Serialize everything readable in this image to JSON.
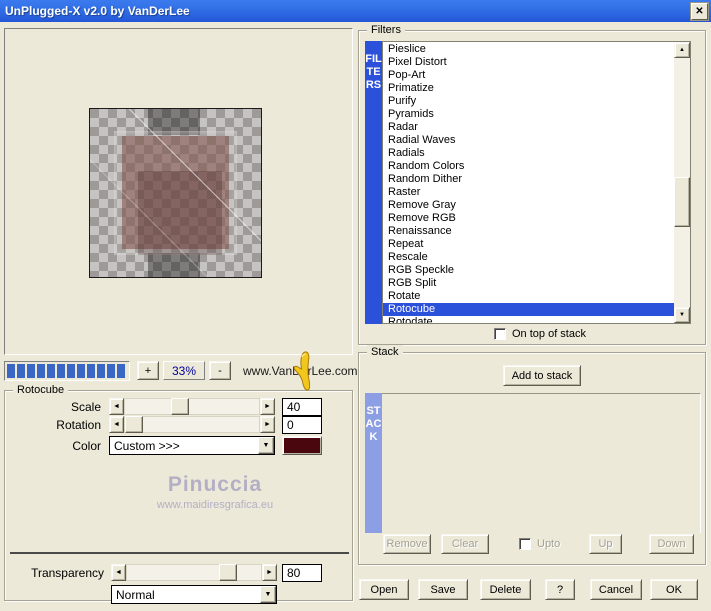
{
  "window": {
    "title": "UnPlugged-X v2.0 by VanDerLee"
  },
  "icons": {
    "close": "✕",
    "plus": "+",
    "minus": "-",
    "arrow_up": "▲",
    "arrow_down": "▼",
    "arrow_left": "◄",
    "arrow_right": "►",
    "dropdown": "▼"
  },
  "preview": {
    "progress_segments": 12,
    "zoom_level": "33%",
    "website": "www.VanDerLee.com"
  },
  "filters": {
    "group_label": "Filters",
    "vertical_label": "FILTERS",
    "items": [
      "Pieslice",
      "Pixel Distort",
      "Pop-Art",
      "Primatize",
      "Purify",
      "Pyramids",
      "Radar",
      "Radial Waves",
      "Radials",
      "Random Colors",
      "Random Dither",
      "Raster",
      "Remove Gray",
      "Remove RGB",
      "Renaissance",
      "Repeat",
      "Rescale",
      "RGB Speckle",
      "RGB Split",
      "Rotate",
      "Rotocube",
      "Rotodate"
    ],
    "selected": "Rotocube",
    "on_top_label": "On top of stack",
    "on_top_checked": false
  },
  "rotocube": {
    "group_label": "Rotocube",
    "scale_label": "Scale",
    "scale_value": "40",
    "rotation_label": "Rotation",
    "rotation_value": "0",
    "color_label": "Color",
    "color_dropdown": "Custom >>>",
    "color_swatch": "#4a070e",
    "transparency_label": "Transparency",
    "transparency_value": "80",
    "blend_mode": "Normal",
    "watermark_line1": "Pinuccia",
    "watermark_line2": "www.maidiresgrafica.eu"
  },
  "stack": {
    "group_label": "Stack",
    "add_button": "Add to stack",
    "vertical_label": "STACK",
    "remove_button": "Remove",
    "clear_button": "Clear",
    "upto_label": "Upto",
    "up_button": "Up",
    "down_button": "Down"
  },
  "actions": {
    "open": "Open",
    "save": "Save",
    "delete": "Delete",
    "help": "?",
    "cancel": "Cancel",
    "ok": "OK"
  },
  "colors": {
    "accent_blue": "#2b50d9",
    "stack_bar": "#8c9fe4",
    "progress": "#3a67c6",
    "titlebar": "#2e6be4",
    "swatch": "#4a070e"
  }
}
